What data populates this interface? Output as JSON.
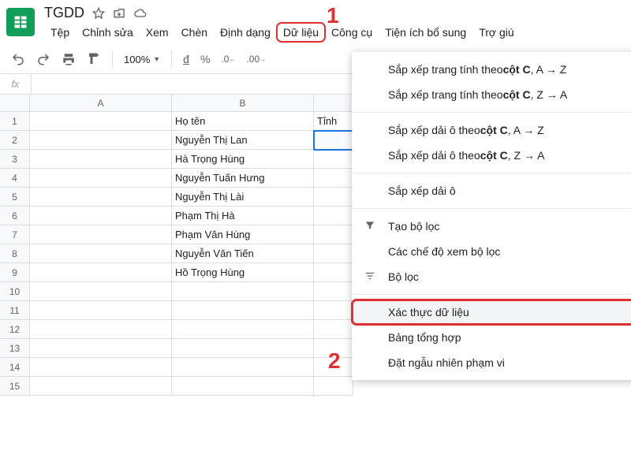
{
  "doc": {
    "title": "TGDD"
  },
  "menu": {
    "file": "Tệp",
    "edit": "Chỉnh sửa",
    "view": "Xem",
    "insert": "Chèn",
    "format": "Định dạng",
    "data": "Dữ liệu",
    "tools": "Công cụ",
    "addons": "Tiện ích bổ sung",
    "help": "Trợ giú"
  },
  "toolbar": {
    "zoom": "100%",
    "currency": "đ",
    "percent": "%",
    "dec_down": ".0̲",
    "dec_up": ".0̲0"
  },
  "fx": {
    "label": "fx",
    "value": ""
  },
  "columns": [
    "A",
    "B"
  ],
  "sheet": {
    "header_b": "Họ tên",
    "header_c": "Tỉnh",
    "rows": [
      "Nguyễn Thị Lan",
      "Hà Trọng Hùng",
      "Nguyễn Tuấn Hưng",
      "Nguyễn Thị Lài",
      "Phạm Thị Hà",
      "Phạm Văn Hùng",
      "Nguyễn Văn Tiến",
      "Hồ Trọng Hùng"
    ]
  },
  "dd": {
    "sort_sheet_az_pre": "Sắp xếp trang tính theo ",
    "sort_sheet_col": "cột C",
    "sort_sheet_az_suf": ", A → Z",
    "sort_sheet_za_suf": ", Z → A",
    "sort_range_pre": "Sắp xếp dải ô theo ",
    "sort_range": "Sắp xếp dải ô",
    "create_filter": "Tạo bộ lọc",
    "filter_views": "Các chế độ xem bộ lọc",
    "filter": "Bộ lọc",
    "data_validation": "Xác thực dữ liệu",
    "pivot": "Bảng tổng hợp",
    "randomize": "Đặt ngẫu nhiên phạm vi"
  },
  "ann": {
    "n1": "1",
    "n2": "2"
  }
}
